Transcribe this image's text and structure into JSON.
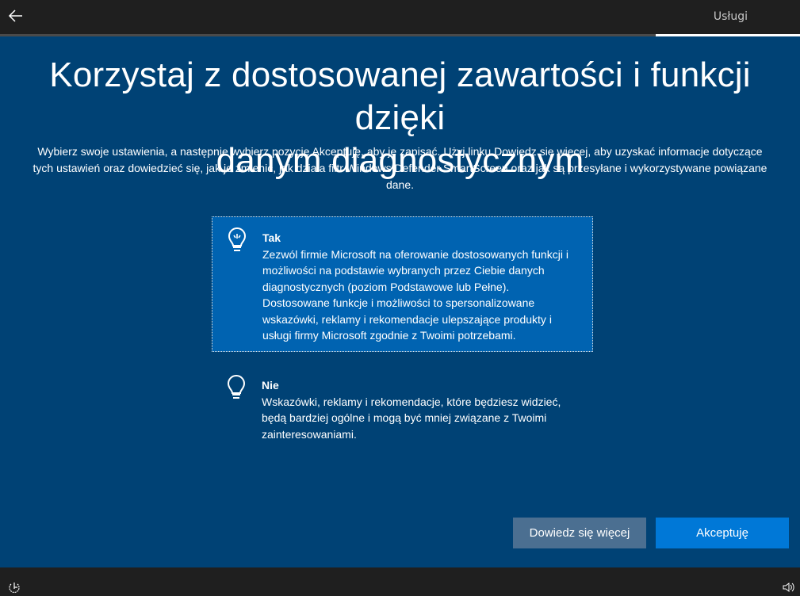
{
  "header": {
    "step_label": "Usługi",
    "progress_percent": 82
  },
  "title": "Korzystaj z dostosowanej zawartości i funkcji dzięki danym diagnostycznym",
  "title_lines": [
    "Korzystaj z dostosowanej zawartości i funkcji dzięki",
    "danym diagnostycznym"
  ],
  "description": "Wybierz swoje ustawienia, a następnie wybierz pozycję Akceptuję, aby je zapisać. Użyj linku Dowiedz się więcej, aby uzyskać informacje dotyczące tych ustawień oraz dowiedzieć się, jak je zmienić, jak działa filtr Windows Defender SmartScreen oraz jak są przesyłane i wykorzystywane powiązane dane.",
  "options": [
    {
      "label": "Tak",
      "text": "Zezwól firmie Microsoft na oferowanie dostosowanych funkcji i możliwości na podstawie wybranych przez Ciebie danych diagnostycznych (poziom Podstawowe lub Pełne). Dostosowane funkcje i możliwości to spersonalizowane wskazówki, reklamy i rekomendacje ulepszające produkty i usługi firmy Microsoft zgodnie z Twoimi potrzebami.",
      "selected": true,
      "icon": "lightbulb-on-icon"
    },
    {
      "label": "Nie",
      "text": "Wskazówki, reklamy i rekomendacje, które będziesz widzieć, będą bardziej ogólne i mogą być mniej związane z Twoimi zainteresowaniami.",
      "selected": false,
      "icon": "lightbulb-off-icon"
    }
  ],
  "buttons": {
    "learn_more": "Dowiedz się więcej",
    "accept": "Akceptuję"
  },
  "colors": {
    "background": "#004275",
    "selected": "#0063b1",
    "accent": "#0078d7",
    "secondary_button": "#4b6f91",
    "bar": "#1f1f1f"
  }
}
